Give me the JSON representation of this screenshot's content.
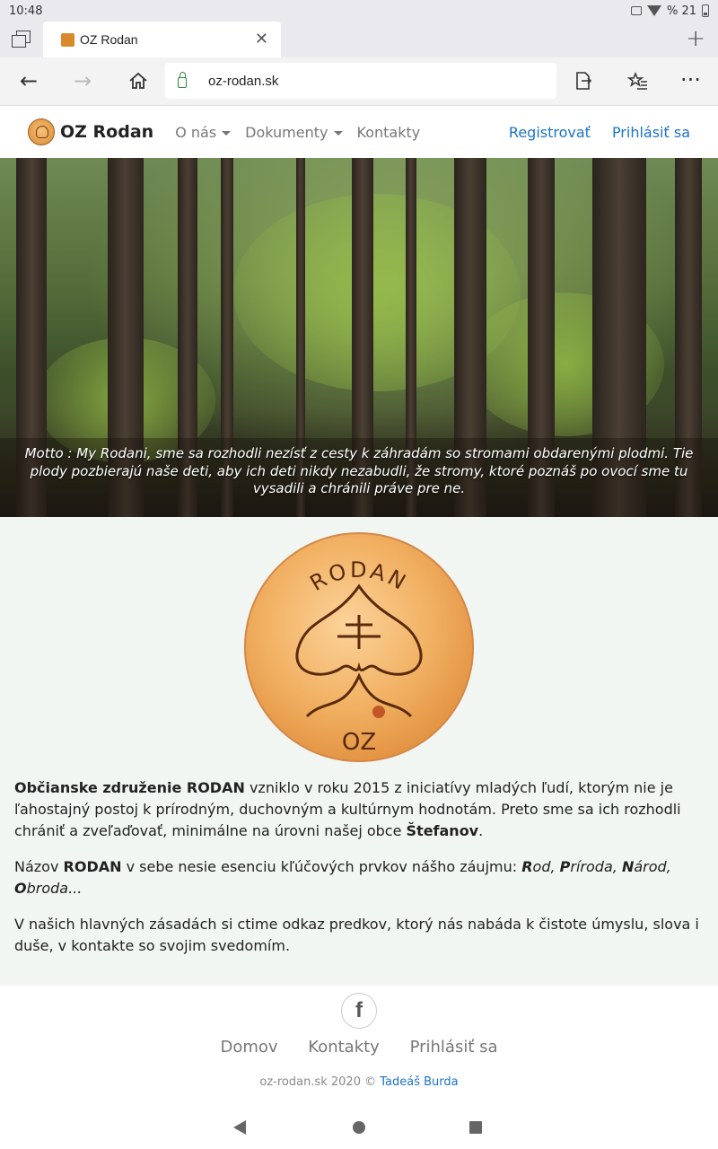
{
  "status_bar": {
    "time": "10:48",
    "battery": "% 21"
  },
  "browser": {
    "tab_title": "OZ Rodan",
    "url": "oz-rodan.sk"
  },
  "navbar": {
    "brand": "OZ Rodan",
    "links": [
      "O nás",
      "Dokumenty",
      "Kontakty"
    ],
    "register": "Registrovať",
    "login": "Prihlásiť sa"
  },
  "hero": {
    "motto": "Motto : My Rodani, sme sa rozhodli nezísť z cesty k záhradám so stromami obdarenými plodmi. Tie plody pozbierajú naše deti, aby ich deti nikdy nezabudli, že stromy, ktoré poznáš po ovocí sme tu vysadili a chránili práve pre ne."
  },
  "emblem": {
    "top_text": "RODAN",
    "bottom_text": "OZ"
  },
  "content": {
    "p1_bold1": "Občianske združenie RODAN",
    "p1_text1": " vzniklo v roku 2015 z iniciatívy mladých ľudí, ktorým nie je ľahostajný postoj k prírodným, duchovným a kultúrnym hodnotám. Preto sme sa ich rozhodli chrániť a zveľaďovať, minimálne na úrovni našej obce ",
    "p1_bold2": "Štefanov",
    "p1_text2": ".",
    "p2_text1": "Názov ",
    "p2_bold": "RODAN",
    "p2_text2": " v sebe nesie esenciu kľúčových prvkov nášho záujmu: ",
    "p2_r": "R",
    "p2_rod": "od, ",
    "p2_p": "P",
    "p2_priroda": "ríroda, ",
    "p2_n": "N",
    "p2_narod": "árod, ",
    "p2_o": "O",
    "p2_obroda": "broda...",
    "p3": "V našich hlavných zásadách si ctime odkaz predkov, ktorý nás nabáda k čistote úmyslu, slova i duše, v kontakte so svojim svedomím."
  },
  "footer": {
    "facebook_icon": "f",
    "links": [
      "Domov",
      "Kontakty",
      "Prihlásiť sa"
    ],
    "copyright_prefix": "oz-rodan.sk 2020 © ",
    "author": "Tadeáš Burda"
  },
  "colors": {
    "link": "#1a73c9",
    "content_bg": "#f1f6f2"
  }
}
